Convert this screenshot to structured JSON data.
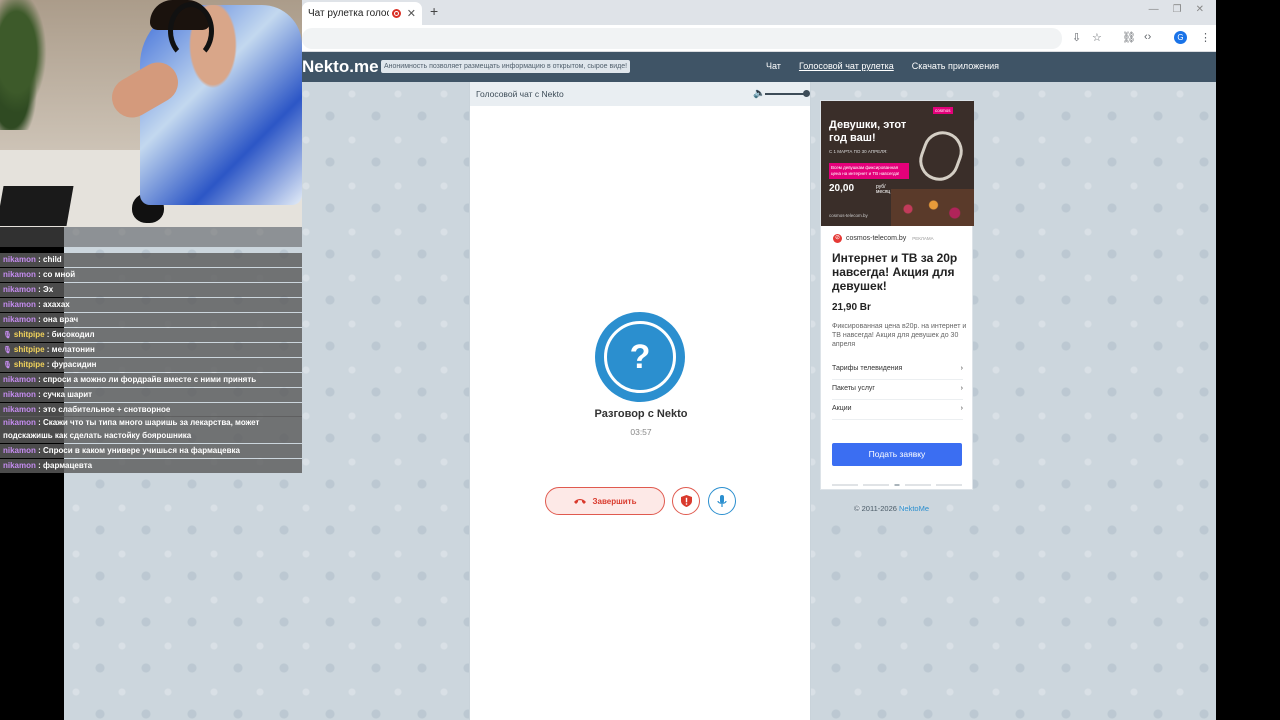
{
  "browser": {
    "tab_title": "Чат рулетка голосов...",
    "tab_close": "✕",
    "new_tab": "+",
    "win_minimize": "—",
    "win_restore": "❐",
    "win_close": "✕",
    "profile_initial": "G"
  },
  "site": {
    "logo": "Nekto.me",
    "anon_note": "Анонимность позволяет размещать информацию в открытом, сырое виде!",
    "nav": [
      "Чат",
      "Голосовой чат рулетка",
      "Скачать приложения"
    ]
  },
  "call": {
    "panel_title": "Голосовой чат с Nekto",
    "avatar_symbol": "?",
    "peer_name": "Разговор с Nekto",
    "timer": "03:57",
    "end_label": "Завершить"
  },
  "ad": {
    "banner": {
      "headline": "Девушки, этот год ваш!",
      "date": "С 1 МАРТА ПО 30 АПРЕЛЯ:",
      "promo": "Всем девушкам фиксированная цена на интернет и ТВ навсегда!",
      "price": "20,00",
      "price_suffix": "руб/ месяц",
      "brand": "cosmos",
      "site": "cosmos-telecom.by"
    },
    "source": "cosmos-telecom.by",
    "label": "РЕКЛАМА",
    "headline": "Интернет и ТВ за 20р навсегда! Акция для девушек!",
    "price": "21,90 Br",
    "description": "Фиксированная цена в20р. на интернет и ТВ навсегда! Акция для девушек до 30 апреля",
    "links": [
      "Тарифы телевидения",
      "Пакеты услуг",
      "Акции"
    ],
    "link_chevron": "›",
    "cta": "Подать заявку"
  },
  "footer": {
    "copyright": "© 2011-2026 ",
    "link": "NektoMe"
  },
  "chat": [
    {
      "user": "nikamon",
      "text": "child",
      "mic": false
    },
    {
      "user": "nikamon",
      "text": "со мной",
      "mic": false
    },
    {
      "user": "nikamon",
      "text": "Эх",
      "mic": false
    },
    {
      "user": "nikamon",
      "text": "ахахах",
      "mic": false
    },
    {
      "user": "nikamon",
      "text": "она врач",
      "mic": false
    },
    {
      "user": "shitpipe",
      "text": "бисокодил",
      "mic": true
    },
    {
      "user": "shitpipe",
      "text": "мелатонин",
      "mic": true
    },
    {
      "user": "shitpipe",
      "text": "фурасидин",
      "mic": true
    },
    {
      "user": "nikamon",
      "text": "спроси а можно ли фордрайв вместе с ними принять",
      "mic": false
    },
    {
      "user": "nikamon",
      "text": "сучка шарит",
      "mic": false
    },
    {
      "user": "nikamon",
      "text": "это слабительное + снотворное",
      "mic": false
    },
    {
      "user": "nikamon",
      "text": "Скажи что ты типа много шаришь за лекарства, может подскажишь как сделать настойку боярошника",
      "mic": false
    },
    {
      "user": "nikamon",
      "text": "Спроси в каком универе учишься на фармацевка",
      "mic": false
    },
    {
      "user": "nikamon",
      "text": "фармацевта",
      "mic": false
    }
  ]
}
